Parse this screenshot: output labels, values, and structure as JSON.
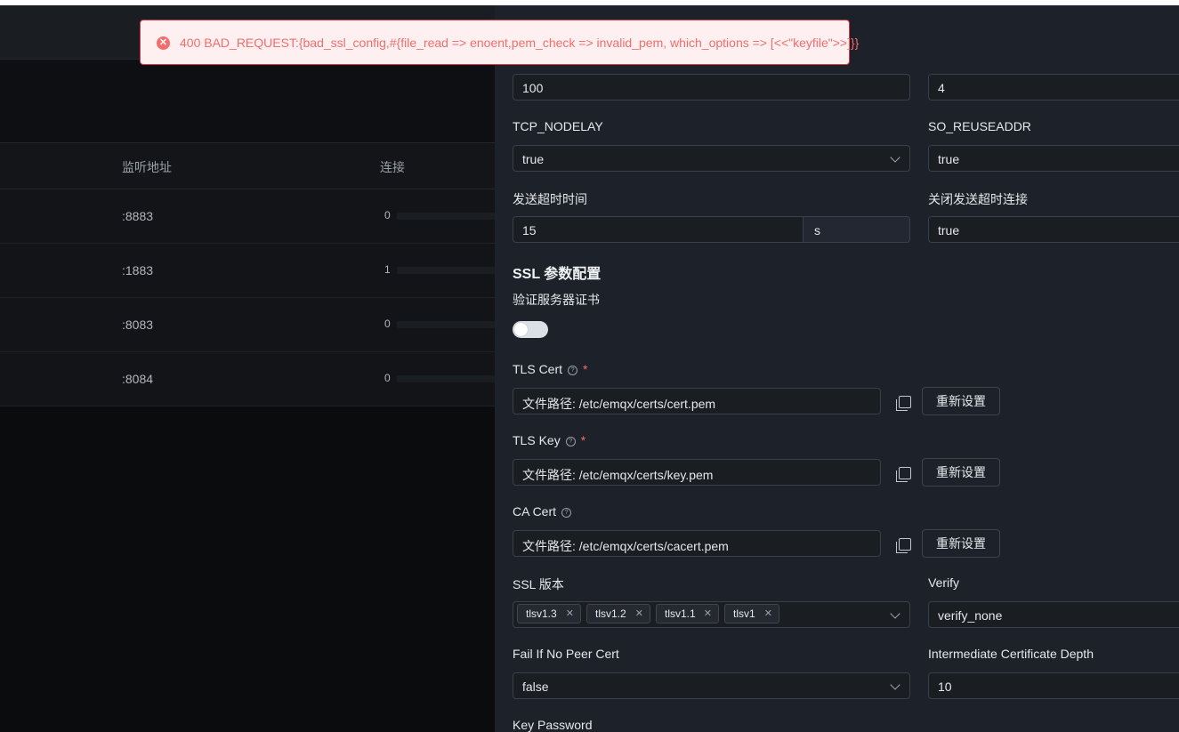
{
  "toast": {
    "message": "400 BAD_REQUEST:{bad_ssl_config,#{file_read => enoent,pem_check => invalid_pem, which_options => [<<\"keyfile\">>]}}",
    "icon": "error-icon"
  },
  "listeners_table": {
    "headers": {
      "address": "监听地址",
      "connections": "连接"
    },
    "rows": [
      {
        "address": ":8883",
        "connections": "0"
      },
      {
        "address": ":1883",
        "connections": "1"
      },
      {
        "address": ":8083",
        "connections": "0"
      },
      {
        "address": ":8084",
        "connections": "0"
      }
    ]
  },
  "form": {
    "top_left_value": "100",
    "top_right_value": "4",
    "tcp_nodelay": {
      "label": "TCP_NODELAY",
      "value": "true"
    },
    "so_reuseaddr": {
      "label": "SO_REUSEADDR",
      "value": "true"
    },
    "send_timeout": {
      "label": "发送超时时间",
      "value": "15",
      "unit": "s"
    },
    "send_timeout_close": {
      "label": "关闭发送超时连接",
      "value": "true"
    },
    "ssl_section_title": "SSL 参数配置",
    "verify_server_cert": {
      "label": "验证服务器证书",
      "enabled": false
    },
    "tls_cert": {
      "label": "TLS Cert",
      "required": "*",
      "value": "文件路径: /etc/emqx/certs/cert.pem",
      "reset_label": "重新设置"
    },
    "tls_key": {
      "label": "TLS Key",
      "required": "*",
      "value": "文件路径: /etc/emqx/certs/key.pem",
      "reset_label": "重新设置"
    },
    "ca_cert": {
      "label": "CA Cert",
      "value": "文件路径: /etc/emqx/certs/cacert.pem",
      "reset_label": "重新设置"
    },
    "ssl_version": {
      "label": "SSL 版本",
      "tags": [
        "tlsv1.3",
        "tlsv1.2",
        "tlsv1.1",
        "tlsv1"
      ]
    },
    "verify": {
      "label": "Verify",
      "value": "verify_none"
    },
    "fail_if_no_peer_cert": {
      "label": "Fail If No Peer Cert",
      "value": "false"
    },
    "intermediate_depth": {
      "label": "Intermediate Certificate Depth",
      "value": "10"
    },
    "key_password": {
      "label": "Key Password"
    }
  },
  "colors": {
    "drawer_bg": "#1d2129",
    "error": "#f56c6c",
    "toast_bg": "#fef0f0"
  }
}
